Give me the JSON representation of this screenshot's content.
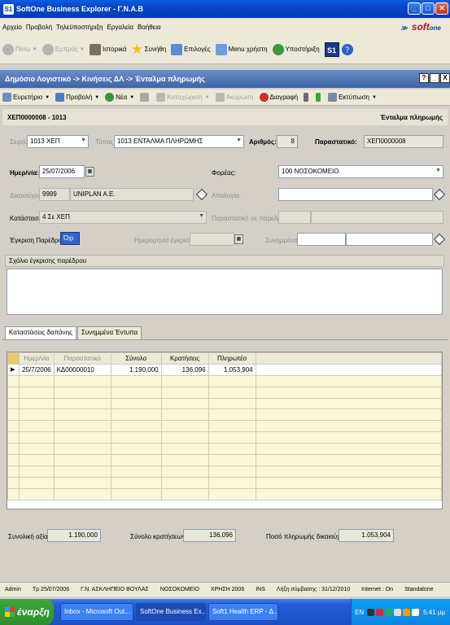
{
  "window": {
    "title": "SoftOne Business Explorer - Γ.Ν.Α.Β",
    "min_glyph": "_",
    "max_glyph": "□",
    "close_glyph": "✕",
    "icon_text": "S1"
  },
  "menu": {
    "items": [
      "Αρχείο",
      "Προβολή",
      "Τηλεϋποστήριξη",
      "Εργαλεία",
      "Βοήθεια"
    ],
    "logo_prefix": "≫",
    "logo_accent": "soft",
    "logo_main": "one"
  },
  "nav": {
    "back": "Πίσω",
    "forward": "Εμπρός",
    "history": "Ιστορικά",
    "favorites": "Συνήθη",
    "options": "Επιλογές",
    "user_menu": "Menu χρήστη",
    "support": "Υποστήριξη",
    "s1_label": "S1",
    "help": "?"
  },
  "doc": {
    "breadcrumb": "Δημόσιο Λογιστικό -> Κινήσεις ΔΛ -> Ένταλμα πληρωμής",
    "help": "?",
    "min": "_",
    "close": "X"
  },
  "toolbar": {
    "find": "Ευρετήριο",
    "view": "Προβολή",
    "new": "Νέα",
    "save": "Καταχώριση",
    "cancel": "Ακύρωση",
    "delete": "Διαγραφή",
    "print": "Εκτύπωση"
  },
  "header": {
    "doc_code": "ΧΕΠ0000008 - 1013",
    "doc_type": "Ένταλμα πληρωμής"
  },
  "form": {
    "series_label": "Σειρά:",
    "series_value": "1013 ΧΕΠ",
    "type_label": "Τύπος:",
    "type_value": "1013 ΕΝΤΑΛΜΑ ΠΛΗΡΩΜΗΣ",
    "number_label": "Αριθμός:",
    "number_value": "8",
    "voucher_label": "Παραστατικό:",
    "voucher_value": "ΧΕΠ0000008",
    "date_label": "Ημερ/νία:",
    "date_value": "25/07/2006",
    "agency_label": "Φορέας:",
    "agency_value": "100 ΝΟΣΟΚΟΜΕΙΟ",
    "beneficiary_label": "Δικαιούχος:",
    "beneficiary_code": "9999",
    "beneficiary_name": "UNIPLAN A.E.",
    "justification_label": "Απολογία:",
    "justification_value": "",
    "status_label": "Κατάσταση:",
    "status_value": "4 Σε ΧΕΠ",
    "prev_voucher_label": "Παραστατικό σε πάρεδρο:",
    "prev_voucher_value": "",
    "approval_label": "Έγκριση Παρέδρου:",
    "approval_value": "Όχι",
    "approval_date_label": "Ημερομηνία έγκρισης:",
    "approval_date_value": "",
    "attached_label": "Συνημμένα:",
    "attached_value": "",
    "comment_section": "Σχόλιο έγκρισης παρέδρου"
  },
  "tabs": [
    "Καταστάσεις δαπάνης",
    "Συνημμένα Έντυπα"
  ],
  "grid": {
    "columns": [
      "Ημερ/νία",
      "Παραστατικό",
      "Σύνολο",
      "Κρατήσεις",
      "Πληρωτέο"
    ],
    "rows": [
      {
        "date": "25/7/2006",
        "voucher": "ΚΔ00000010",
        "total": "1.190,000",
        "deductions": "136,096",
        "payable": "1.053,904"
      }
    ]
  },
  "totals": {
    "total_label": "Συνολική αξία:",
    "total_value": "1.190,000",
    "deductions_label": "Σύνολο κρατήσεων:",
    "deductions_value": "136,096",
    "payable_label": "Ποσό πληρωμής δικαιούχου:",
    "payable_value": "1.053,904"
  },
  "status": {
    "user": "Admin",
    "date": "Τρ 25/07/2006",
    "org": "Γ.Ν. ΑΣΚΛΗΠΕΙΟ ΒΟΥΛΑΣ",
    "unit": "ΝΟΣΟΚΟΜΕΙΟ",
    "year": "ΧΡΗΣΗ 2006",
    "ins": "INS",
    "expiry": "Λήξη σύμβασης : 31/12/2010",
    "internet": "Internet : On",
    "mode": "Standalone"
  },
  "taskbar": {
    "start": "έναρξη",
    "tasks": [
      "Inbox - Microsoft Out...",
      "SoftOne Business Ex...",
      "Soft1 Health ERP - Δ..."
    ],
    "lang": "EN",
    "time": "5:41 μμ"
  },
  "colors": {
    "title_blue": "#0845c8",
    "doc_title": "#3d64a8",
    "grid_row": "#fbf8d9"
  }
}
